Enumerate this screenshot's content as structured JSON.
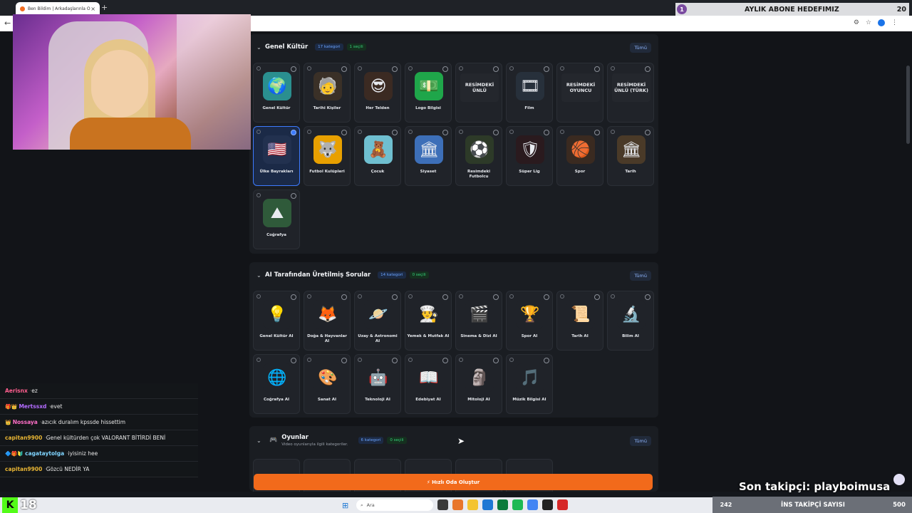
{
  "browser": {
    "tab_title": "Ben Bildim | Arkadaşlarınla Onli",
    "tab_close": "×",
    "new_tab": "+",
    "back": "←"
  },
  "sections": [
    {
      "title": "Genel Kültür",
      "count_badge": "17 kategori",
      "selected_badge": "1 seçili",
      "all_button": "Tümü",
      "cards": [
        {
          "label": "Genel Kültür",
          "icon": "🌍",
          "icon_name": "globe-book-icon",
          "bg": "#2a8f8f",
          "selected": false
        },
        {
          "label": "Tarihi Kişiler",
          "icon": "🧓",
          "icon_name": "historic-person-icon",
          "bg": "#3a3027",
          "selected": false
        },
        {
          "label": "Her Telden",
          "icon": "😎",
          "icon_name": "mixed-person-icon",
          "bg": "#3b2a22",
          "selected": false
        },
        {
          "label": "Logo Bilgisi",
          "icon": "💵",
          "icon_name": "logo-icon",
          "bg": "#1fa64a",
          "selected": false
        },
        {
          "label": "",
          "tile": "RESİMDEKİ ÜNLÜ",
          "selected": false
        },
        {
          "label": "Film",
          "icon": "🎞",
          "icon_name": "film-reel-icon",
          "bg": "#27303b",
          "selected": false
        },
        {
          "label": "",
          "tile": "RESİMDEKİ OYUNCU",
          "selected": false
        },
        {
          "label": "",
          "tile": "RESİMDEKİ ÜNLÜ (TÜRK)",
          "selected": false
        },
        {
          "label": "Ülke Bayrakları",
          "icon": "🇺🇸",
          "icon_name": "flag-icon",
          "bg": "#22314f",
          "selected": true
        },
        {
          "label": "Futbol Kulüpleri",
          "icon": "🐺",
          "icon_name": "club-crest-icon",
          "bg": "#e8a000",
          "selected": false
        },
        {
          "label": "Çocuk",
          "icon": "🧸",
          "icon_name": "child-icon",
          "bg": "#6fbfd0",
          "selected": false
        },
        {
          "label": "Siyaset",
          "icon": "🏛",
          "icon_name": "parliament-icon",
          "bg": "#3d6fb8",
          "selected": false
        },
        {
          "label": "Resimdeki Futbolcu",
          "icon": "⚽",
          "icon_name": "footballer-icon",
          "bg": "#2d3a28",
          "selected": false
        },
        {
          "label": "Süper Lig",
          "icon": "🛡",
          "icon_name": "league-logo-icon",
          "bg": "#2a1a1e",
          "selected": false
        },
        {
          "label": "Spor",
          "icon": "🏀",
          "icon_name": "sports-balls-icon",
          "bg": "#3a2a20",
          "selected": false
        },
        {
          "label": "Tarih",
          "icon": "🏛",
          "icon_name": "colosseum-icon",
          "bg": "#4a3a28",
          "selected": false
        },
        {
          "label": "Coğrafya",
          "icon": "⛰",
          "icon_name": "mountain-icon",
          "bg": "#2f5a3a",
          "selected": false
        }
      ]
    },
    {
      "title": "AI Tarafından Üretilmiş Sorular",
      "count_badge": "14 kategori",
      "selected_badge": "0 seçili",
      "all_button": "Tümü",
      "cards": [
        {
          "label": "Genel Kültür AI",
          "icon": "💡",
          "icon_name": "lightbulb-icon",
          "bg": "#202329"
        },
        {
          "label": "Doğa & Hayvanlar AI",
          "icon": "🦊",
          "icon_name": "fox-icon",
          "bg": "#202329"
        },
        {
          "label": "Uzay & Astronomi AI",
          "icon": "🪐",
          "icon_name": "planet-icon",
          "bg": "#202329"
        },
        {
          "label": "Yemek & Mutfak AI",
          "icon": "👨‍🍳",
          "icon_name": "chef-icon",
          "bg": "#202329"
        },
        {
          "label": "Sinema & Dizi AI",
          "icon": "🎬",
          "icon_name": "clapperboard-icon",
          "bg": "#202329"
        },
        {
          "label": "Spor AI",
          "icon": "🏆",
          "icon_name": "trophy-icon",
          "bg": "#202329"
        },
        {
          "label": "Tarih AI",
          "icon": "📜",
          "icon_name": "scroll-icon",
          "bg": "#202329"
        },
        {
          "label": "Bilim AI",
          "icon": "🔬",
          "icon_name": "microscope-icon",
          "bg": "#202329"
        },
        {
          "label": "Coğrafya AI",
          "icon": "🌐",
          "icon_name": "earth-icon",
          "bg": "#202329"
        },
        {
          "label": "Sanat AI",
          "icon": "🎨",
          "icon_name": "palette-icon",
          "bg": "#202329"
        },
        {
          "label": "Teknoloji AI",
          "icon": "🤖",
          "icon_name": "robot-icon",
          "bg": "#202329"
        },
        {
          "label": "Edebiyat AI",
          "icon": "📖",
          "icon_name": "book-icon",
          "bg": "#202329"
        },
        {
          "label": "Mitoloji AI",
          "icon": "🗿",
          "icon_name": "statue-icon",
          "bg": "#202329"
        },
        {
          "label": "Müzik Bilgisi AI",
          "icon": "🎵",
          "icon_name": "music-note-icon",
          "bg": "#202329"
        }
      ]
    },
    {
      "title": "Oyunlar",
      "subtitle": "Video oyunlarıyla ilgili kategoriler.",
      "count_badge": "6 kategori",
      "selected_badge": "0 seçili",
      "all_button": "Tümü"
    }
  ],
  "create_button": "⚡ Hızlı Oda Oluştur",
  "overlay": {
    "goal_number": "1",
    "goal_label": "AYLIK ABONE HEDEFIMIZ",
    "goal_count": "20",
    "last_follower": "Son takipçi: playboimusa",
    "kick_logo": "K",
    "kick_viewers": "18",
    "tray_left": "242",
    "tray_mid": "İNS TAKİPÇİ SAYISI",
    "tray_right": "500"
  },
  "chat": [
    {
      "user": "Aerisnx",
      "msg": "ez",
      "color": "#ff5f8f",
      "badges": ""
    },
    {
      "user": "Mertssxd",
      "msg": "evet",
      "color": "#b36cff",
      "badges": "🎁👑"
    },
    {
      "user": "Nossaya",
      "msg": "azıcık duralım kpssde hissettim",
      "color": "#ff6fc8",
      "badges": "👑"
    },
    {
      "user": "capitan9900",
      "msg": "Genel kültürden çok VALORANT BİTİRDİ BENİ",
      "color": "#e8b534",
      "badges": ""
    },
    {
      "user": "cagataytolga",
      "msg": "iyisiniz hee",
      "color": "#7fd4ff",
      "badges": "🔷🎁🔰"
    },
    {
      "user": "capitan9900",
      "msg": "Gözcü NEDİR YA",
      "color": "#e8b534",
      "badges": ""
    }
  ],
  "taskbar": {
    "search_placeholder": "Ara"
  }
}
